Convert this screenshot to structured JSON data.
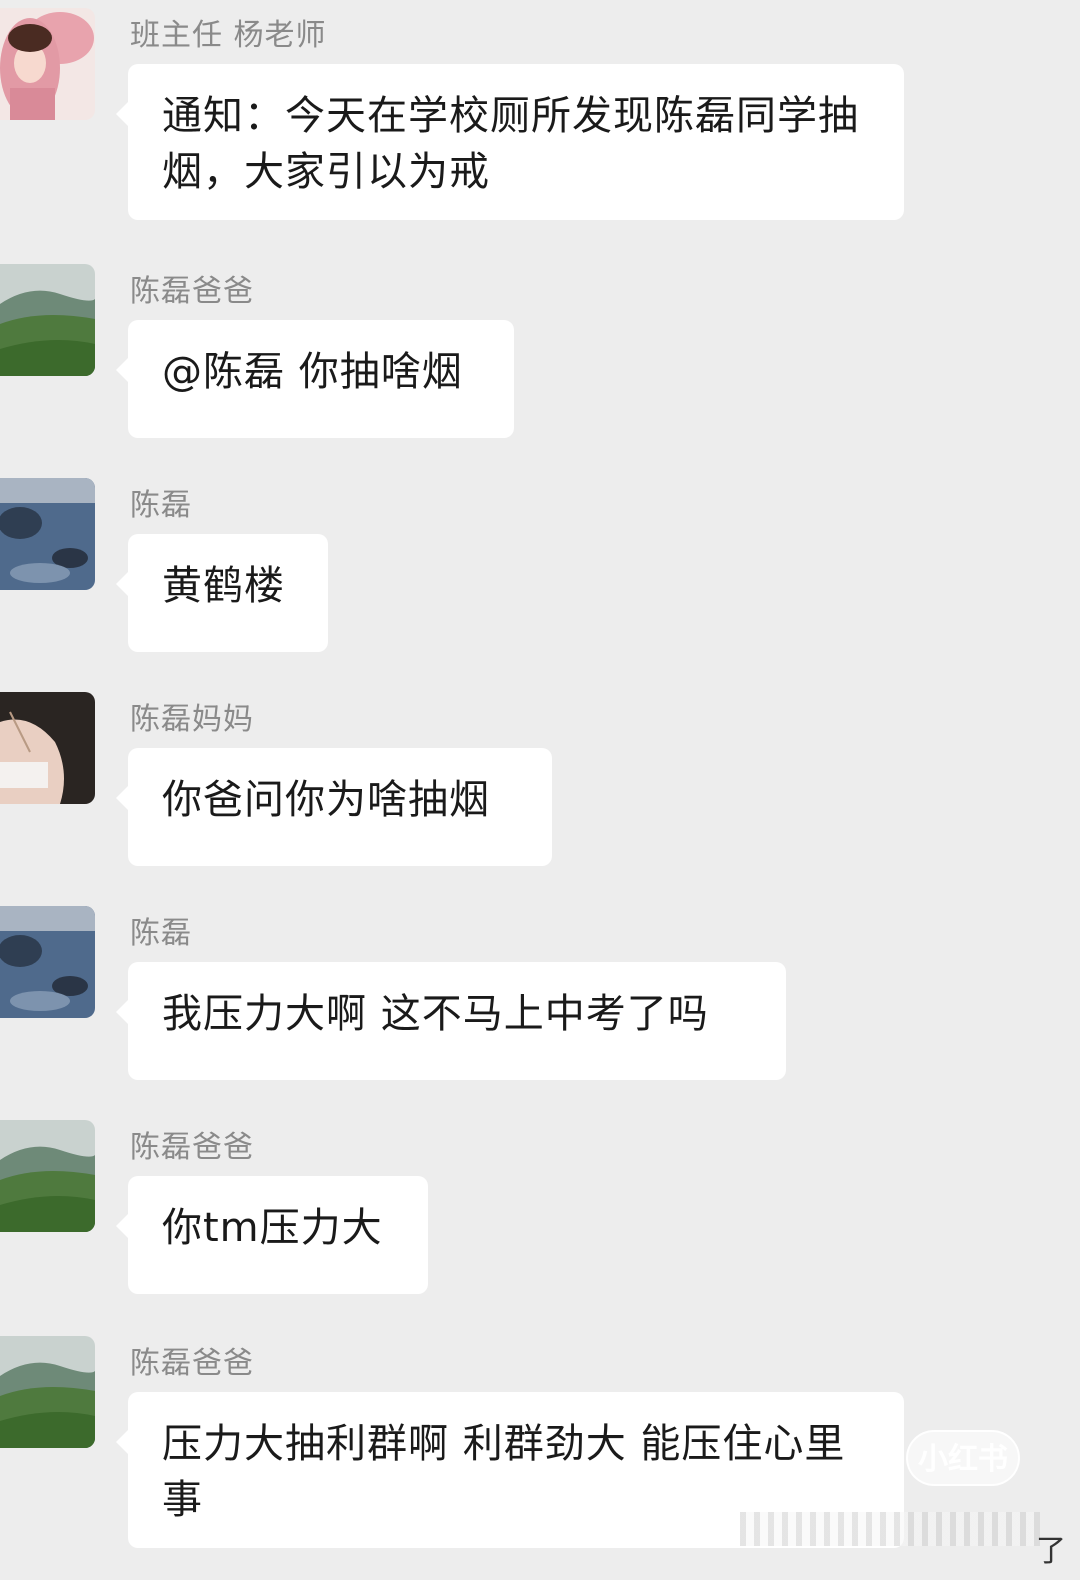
{
  "messages": [
    {
      "sender": "班主任 杨老师",
      "avatar": "girl-pink-hood-avatar",
      "text": "通知：今天在学校厕所发现陈磊同学抽烟，大家引以为戒"
    },
    {
      "sender": "陈磊爸爸",
      "avatar": "green-hills-avatar",
      "text": "@陈磊 你抽啥烟"
    },
    {
      "sender": "陈磊",
      "avatar": "blue-rocks-avatar",
      "text": "黄鹤楼"
    },
    {
      "sender": "陈磊妈妈",
      "avatar": "woman-shoulder-avatar",
      "text": "你爸问你为啥抽烟"
    },
    {
      "sender": "陈磊",
      "avatar": "blue-rocks-avatar",
      "text": "我压力大啊 这不马上中考了吗"
    },
    {
      "sender": "陈磊爸爸",
      "avatar": "green-hills-avatar",
      "text": "你tm压力大"
    },
    {
      "sender": "陈磊爸爸",
      "avatar": "green-hills-avatar",
      "text": "压力大抽利群啊 利群劲大 能压住心里事"
    }
  ],
  "watermark": "小红书",
  "corner_text": "了",
  "colors": {
    "background": "#ededed",
    "bubble": "#ffffff",
    "sender_text": "#8a8a8a",
    "message_text": "#1a1a1a"
  }
}
